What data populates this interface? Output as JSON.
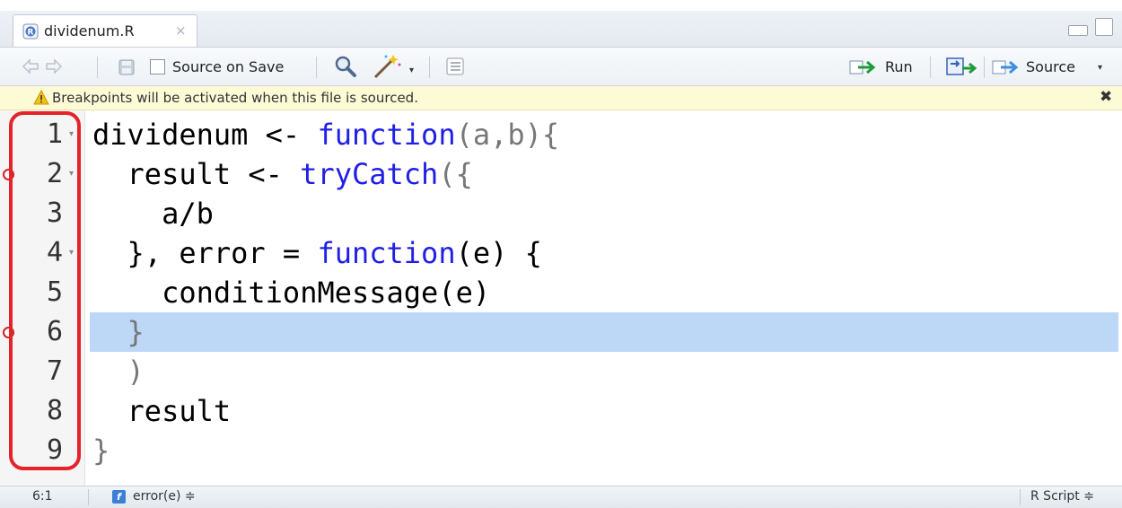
{
  "tab": {
    "filename": "dividenum.R",
    "close_glyph": "×"
  },
  "toolbar": {
    "source_on_save_label": "Source on Save",
    "run_label": "Run",
    "source_label": "Source",
    "dropdown_glyph": "▾"
  },
  "notice": {
    "text": "Breakpoints will be activated when this file is sourced.",
    "close_glyph": "✖"
  },
  "gutter": {
    "line_numbers": [
      "1",
      "2",
      "3",
      "4",
      "5",
      "6",
      "7",
      "8",
      "9"
    ],
    "breakpoint_lines": [
      2,
      6
    ],
    "fold_lines": [
      1,
      2,
      4
    ]
  },
  "code": {
    "highlighted_line": 6,
    "lines": [
      [
        {
          "t": "dividenum <- "
        },
        {
          "t": "function",
          "c": "kw"
        },
        {
          "t": "(a,b){",
          "c": "br"
        }
      ],
      [
        {
          "t": "  result <- "
        },
        {
          "t": "tryCatch",
          "c": "kw"
        },
        {
          "t": "({",
          "c": "br"
        }
      ],
      [
        {
          "t": "    a/b"
        }
      ],
      [
        {
          "t": "  }, error = ",
          "c": ""
        },
        {
          "t": "function",
          "c": "kw"
        },
        {
          "t": "(e) {",
          "c": ""
        }
      ],
      [
        {
          "t": "    conditionMessage(e)"
        }
      ],
      [
        {
          "t": "  }",
          "c": "br"
        }
      ],
      [
        {
          "t": "  )",
          "c": "br"
        }
      ],
      [
        {
          "t": "  result"
        }
      ],
      [
        {
          "t": "}",
          "c": "br"
        }
      ]
    ]
  },
  "status": {
    "position": "6:1",
    "function_scope": "error(e) ≑",
    "file_type": "R Script ≑"
  },
  "colors": {
    "keyword": "#1f1fe6",
    "breakpoint": "#d22222",
    "highlight": "#bdd7f7",
    "annotation_box": "#e4232b"
  }
}
